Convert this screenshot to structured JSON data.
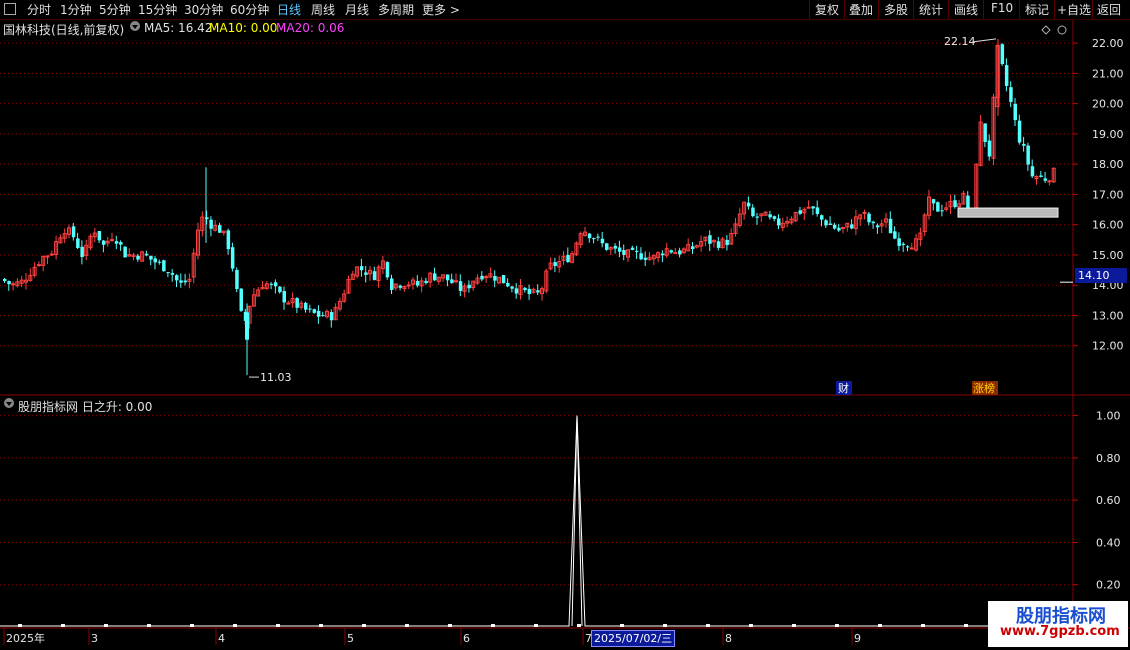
{
  "toolbar": {
    "periods": [
      "分时",
      "1分钟",
      "5分钟",
      "15分钟",
      "30分钟",
      "60分钟",
      "日线",
      "周线",
      "月线",
      "多周期",
      "更多 >"
    ],
    "active_period": "日线",
    "right_buttons": [
      "复权",
      "叠加",
      "多股",
      "统计",
      "画线",
      "F10",
      "标记",
      "+自选",
      "返回"
    ]
  },
  "main_chart": {
    "title": "国林科技(日线,前复权)",
    "ma5": "MA5: 16.42",
    "ma10": "MA10: 0.00",
    "ma20": "MA20: 0.06",
    "high_label": "22.14",
    "low_label": "11.03",
    "current_price": "14.10",
    "price_ticks": [
      "22.00",
      "21.00",
      "20.00",
      "19.00",
      "18.00",
      "17.00",
      "16.00",
      "15.00",
      "14.00",
      "13.00",
      "12.00"
    ],
    "markers": {
      "cai": "财",
      "zhangbang": "涨榜"
    },
    "colors": {
      "up": "#ff4040",
      "down": "#54ffff",
      "grid": "#8b0000",
      "ma10": "#ffff00",
      "ma20": "#ff40ff"
    }
  },
  "sub_chart": {
    "title": "股朋指标网 日之升: 0.00",
    "value_ticks": [
      "1.00",
      "0.80",
      "0.60",
      "0.40",
      "0.20"
    ]
  },
  "date_axis": {
    "labels": [
      "2025年",
      "3",
      "4",
      "5",
      "6",
      "7",
      "8",
      "9"
    ],
    "cursor_date": "2025/07/02/三"
  },
  "watermark": {
    "name": "股朋指标网",
    "url": "www.7gpzb.com"
  },
  "chart_data": {
    "type": "candlestick",
    "title": "国林科技(日线,前复权)",
    "ylim": [
      11,
      22.5
    ],
    "high": 22.14,
    "low": 11.03,
    "indicator": {
      "name": "日之升",
      "ylim": [
        0,
        1.05
      ],
      "values_nonzero": [
        {
          "date": "2025/07/02",
          "value": 1.0
        }
      ]
    }
  }
}
